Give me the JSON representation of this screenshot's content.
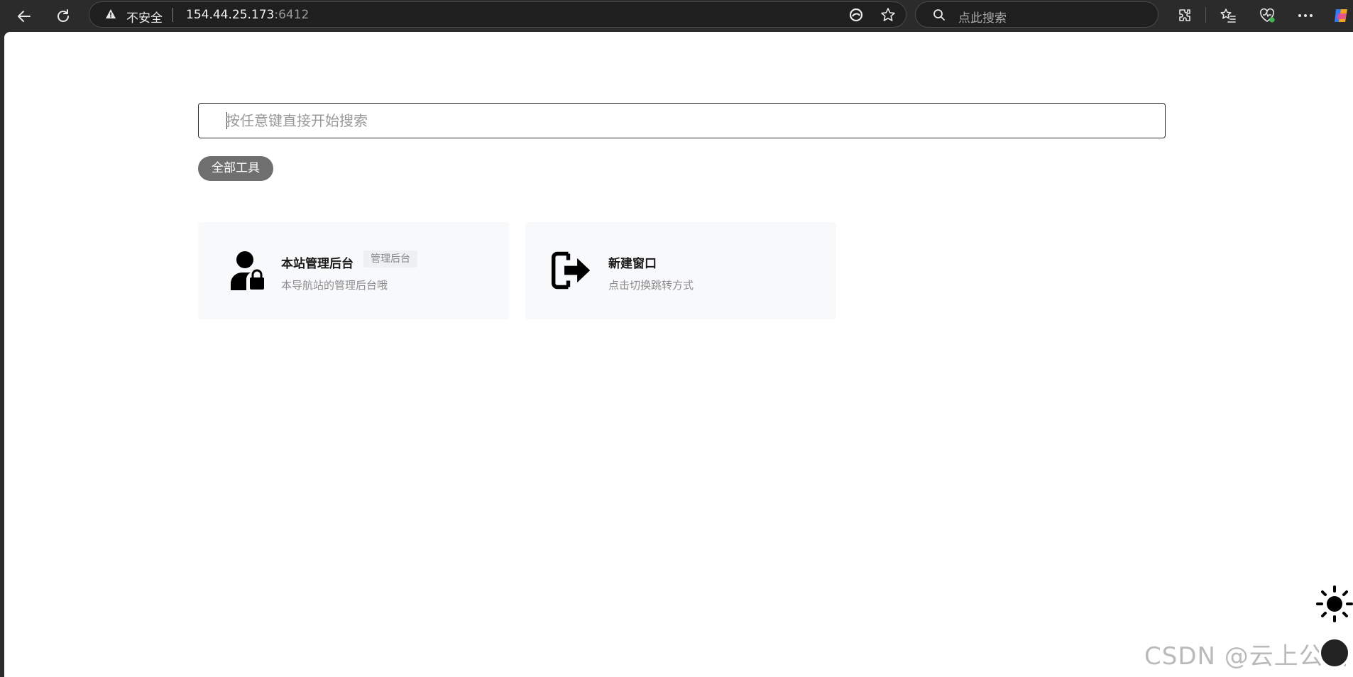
{
  "browser": {
    "security_label": "不安全",
    "url_host": "154.44.25.173",
    "url_port": ":6412",
    "search_placeholder": "点此搜索"
  },
  "search": {
    "placeholder": "按任意键直接开始搜索"
  },
  "filter": {
    "all_tools_label": "全部工具"
  },
  "cards": [
    {
      "title": "本站管理后台",
      "tag": "管理后台",
      "description": "本导航站的管理后台哦",
      "icon": "user-lock-icon"
    },
    {
      "title": "新建窗口",
      "description": "点击切换跳转方式",
      "icon": "sign-out-icon"
    }
  ],
  "watermark": "CSDN @云上公园",
  "colors": {
    "chrome_bg": "#2b2b2b",
    "page_bg": "#ffffff",
    "card_bg": "#f8f9fb",
    "pill_bg": "#6f6f6f"
  }
}
